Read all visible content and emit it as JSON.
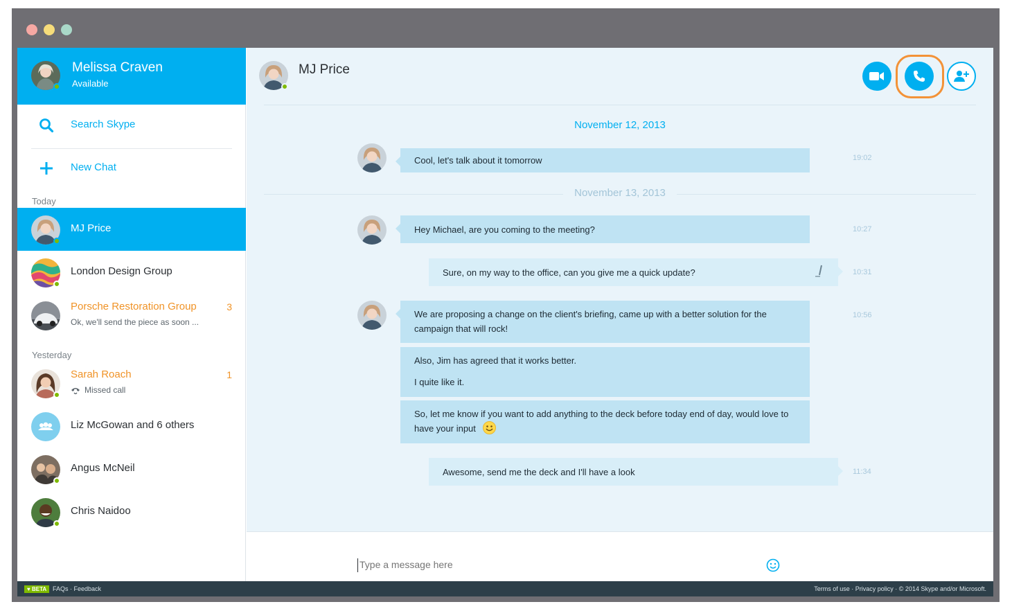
{
  "window": {
    "lights": [
      {
        "name": "close",
        "color": "#f6a8a3"
      },
      {
        "name": "minimize",
        "color": "#f6dc7a"
      },
      {
        "name": "maximize",
        "color": "#a9d8c8"
      }
    ]
  },
  "colors": {
    "brand": "#00aff0",
    "unread": "#f09327",
    "presence": "#7fba00",
    "highlight": "#f39237"
  },
  "profile": {
    "name": "Melissa Craven",
    "status": "Available"
  },
  "actions": {
    "search_label": "Search Skype",
    "new_chat_label": "New Chat"
  },
  "sections": {
    "today": "Today",
    "yesterday": "Yesterday"
  },
  "chats": [
    {
      "name": "MJ Price",
      "active": true,
      "online": true
    },
    {
      "name": "London Design Group",
      "online": true
    },
    {
      "name": "Porsche Restoration Group",
      "unread": "3",
      "preview": "Ok, we'll send the piece as soon ..."
    },
    {
      "name": "Sarah Roach",
      "unread": "1",
      "preview": "Missed call",
      "online": true
    },
    {
      "name": "Liz McGowan and 6 others"
    },
    {
      "name": "Angus McNeil",
      "online": true
    },
    {
      "name": "Chris Naidoo",
      "online": true
    }
  ],
  "conversation": {
    "contact": "MJ Price",
    "header_buttons": [
      {
        "name": "video-call",
        "icon": "video-icon",
        "style": "filled"
      },
      {
        "name": "audio-call",
        "icon": "phone-icon",
        "style": "filled",
        "highlighted": true
      },
      {
        "name": "add-contact",
        "icon": "add-person-icon",
        "style": "outline"
      }
    ],
    "dates": [
      "November 12, 2013",
      "November 13, 2013"
    ],
    "messages": [
      {
        "dir": "in",
        "text": "Cool, let's talk about it tomorrow",
        "time": "19:02"
      },
      {
        "dir": "in",
        "text": "Hey Michael, are you coming to the meeting?",
        "time": "10:27"
      },
      {
        "dir": "out",
        "text": "Sure, on my way to the office, can you give me a quick update?",
        "time": "10:31",
        "edited": true
      },
      {
        "dir": "in",
        "text": "We are proposing a change on the client's briefing, came up with a better solution for the campaign that will rock!",
        "time": "10:56"
      },
      {
        "dir": "in",
        "text": "Also, Jim has agreed that it works better.",
        "text2": "I quite like it."
      },
      {
        "dir": "in",
        "text": "So, let me know if you want to add anything to the deck before today end of day, would love to have your input"
      },
      {
        "dir": "out",
        "text": "Awesome, send me the deck and I'll have a look",
        "time": "11:34"
      }
    ],
    "composer_placeholder": "Type a message here"
  },
  "footer": {
    "beta": "♥ BETA",
    "faqs": "FAQs",
    "feedback": "Feedback",
    "terms": "Terms of use",
    "privacy": "Privacy policy",
    "copyright": "© 2014 Skype and/or Microsoft."
  }
}
